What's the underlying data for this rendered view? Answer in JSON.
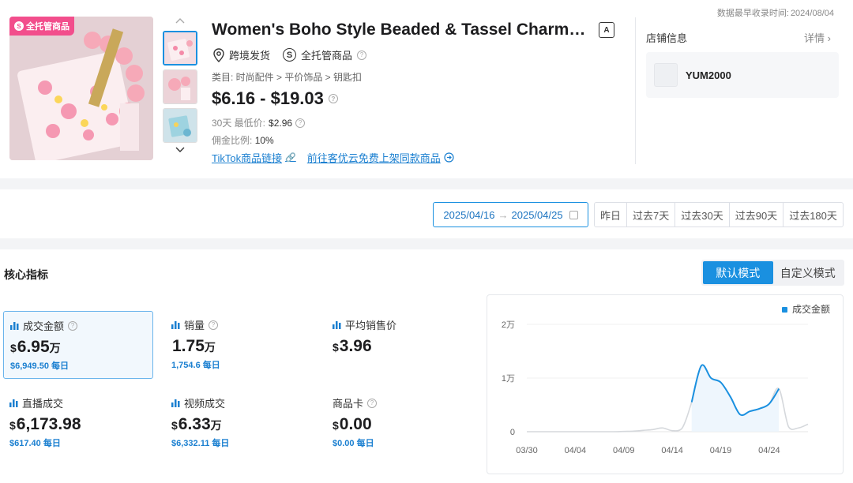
{
  "header": {
    "last_update_label": "数据最早收录时间:",
    "last_update_value": "2024/08/04"
  },
  "product": {
    "badge": "全托管商品",
    "badge_coin": "S",
    "title": "Women's Boho Style Beaded & Tassel Charms ...",
    "translate_icon": "translate-icon",
    "ship_label": "跨境发货",
    "managed_label": "全托管商品",
    "managed_letter": "S",
    "category": "类目: 时尚配件 > 平价饰品 > 钥匙扣",
    "price": "$6.16 - $19.03",
    "lowest_label": "30天 最低价:",
    "lowest_value": "$2.96",
    "commission_label": "佣金比例:",
    "commission_value": "10%",
    "link_tiktok": "TikTok商品链接",
    "link_list": "前往客优云免费上架同款商品"
  },
  "shop": {
    "title": "店铺信息",
    "more": "详情",
    "name": "YUM2000"
  },
  "date_filter": {
    "start": "2025/04/16",
    "end": "2025/04/25",
    "separator": "→",
    "periods": [
      "昨日",
      "过去7天",
      "过去30天",
      "过去90天",
      "过去180天"
    ]
  },
  "core": {
    "title": "核心指标",
    "modes": [
      "默认模式",
      "自定义模式"
    ],
    "metrics": [
      {
        "label": "成交金额",
        "currency": "$",
        "value": "6.95",
        "unit": "万",
        "sub": "$6,949.50 每日",
        "help": true
      },
      {
        "label": "销量",
        "currency": "",
        "value": "1.75",
        "unit": "万",
        "sub": "1,754.6 每日",
        "help": true
      },
      {
        "label": "平均销售价",
        "currency": "$",
        "value": "3.96",
        "unit": "",
        "sub": "",
        "help": false
      },
      {
        "label": "直播成交",
        "currency": "$",
        "value": "6,173.98",
        "unit": "",
        "sub": "$617.40 每日",
        "help": false
      },
      {
        "label": "视频成交",
        "currency": "$",
        "value": "6.33",
        "unit": "万",
        "sub": "$6,332.11 每日",
        "help": false
      },
      {
        "label": "商品卡",
        "currency": "$",
        "value": "0.00",
        "unit": "",
        "sub": "$0.00 每日",
        "help": true
      }
    ]
  },
  "chart_data": {
    "type": "area",
    "legend": "成交金额",
    "legend_position": "top-right",
    "accent": "#1a90e0",
    "y_ticks": [
      "0",
      "1万",
      "2万"
    ],
    "ylim": [
      0,
      20000
    ],
    "x_ticks": [
      "03/30",
      "04/04",
      "04/09",
      "04/14",
      "04/19",
      "04/24"
    ],
    "series": [
      {
        "name": "成交金额",
        "x": [
          "03/30",
          "03/31",
          "04/01",
          "04/02",
          "04/03",
          "04/04",
          "04/05",
          "04/06",
          "04/07",
          "04/08",
          "04/09",
          "04/10",
          "04/11",
          "04/12",
          "04/13",
          "04/14",
          "04/15",
          "04/16",
          "04/17",
          "04/18",
          "04/19",
          "04/20",
          "04/21",
          "04/22",
          "04/23",
          "04/24",
          "04/25",
          "04/26",
          "04/27",
          "04/28"
        ],
        "values": [
          0,
          0,
          0,
          0,
          0,
          0,
          0,
          0,
          0,
          0,
          50,
          100,
          250,
          400,
          700,
          200,
          600,
          5500,
          12300,
          10000,
          9200,
          6500,
          3200,
          3800,
          4300,
          5200,
          8000,
          900,
          700,
          1400
        ],
        "highlight_range": [
          "04/16",
          "04/25"
        ]
      }
    ]
  }
}
